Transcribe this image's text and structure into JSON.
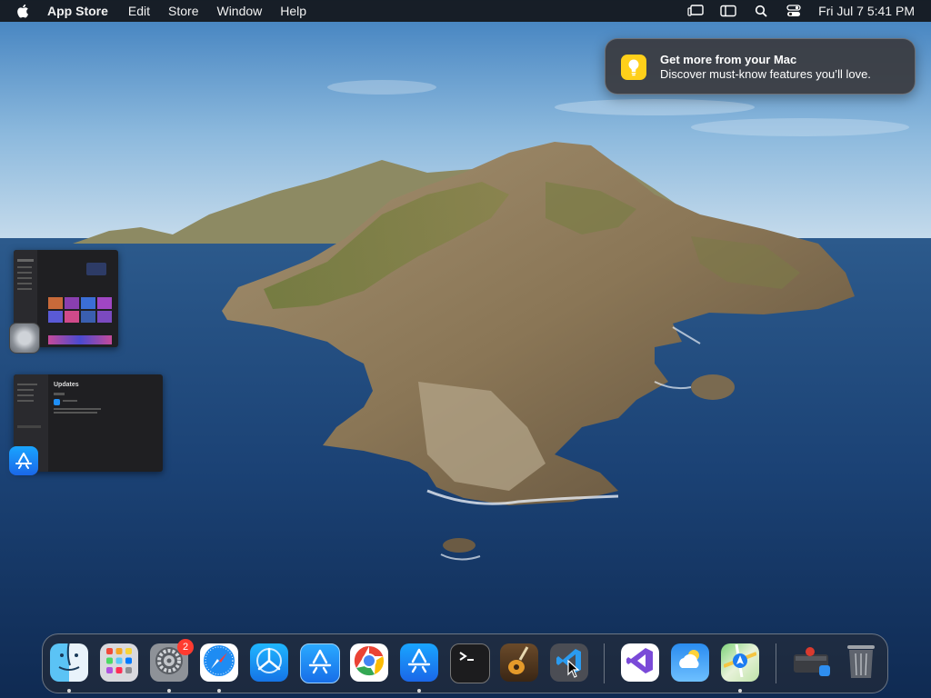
{
  "menubar": {
    "app_name": "App Store",
    "items": [
      "Edit",
      "Store",
      "Window",
      "Help"
    ],
    "status_icons": [
      "stage-manager-icon",
      "sidebar-icon",
      "search-icon",
      "control-center-icon"
    ],
    "clock": "Fri Jul 7  5:41 PM"
  },
  "notification": {
    "title": "Get more from your Mac",
    "body": "Discover must-know features you’ll love.",
    "icon": "lightbulb-icon",
    "accent": "#ffd01a"
  },
  "stage_windows": [
    {
      "app": "System Settings",
      "icon": "system-settings-icon"
    },
    {
      "app": "App Store",
      "icon": "app-store-icon",
      "heading": "Updates"
    }
  ],
  "dock": {
    "apps": [
      {
        "name": "Finder",
        "icon": "finder-icon",
        "running": true
      },
      {
        "name": "Launchpad",
        "icon": "launchpad-icon",
        "running": false
      },
      {
        "name": "System Settings",
        "icon": "system-settings-icon",
        "running": true,
        "badge": "2"
      },
      {
        "name": "Safari",
        "icon": "safari-icon",
        "running": true
      },
      {
        "name": "TestFlight",
        "icon": "testflight-icon",
        "running": false
      },
      {
        "name": "App Store Connect",
        "icon": "app-store-connect-icon",
        "running": false
      },
      {
        "name": "Google Chrome",
        "icon": "chrome-icon",
        "running": false
      },
      {
        "name": "App Store",
        "icon": "app-store-icon",
        "running": true
      },
      {
        "name": "Terminal",
        "icon": "terminal-icon",
        "running": false
      },
      {
        "name": "GarageBand",
        "icon": "garageband-icon",
        "running": false
      },
      {
        "name": "Visual Studio Code",
        "icon": "vscode-icon",
        "running": false
      },
      {
        "name": "Visual Studio",
        "icon": "visual-studio-icon",
        "running": false
      },
      {
        "name": "Weather",
        "icon": "weather-icon",
        "running": false
      },
      {
        "name": "Maps",
        "icon": "maps-icon",
        "running": true
      }
    ],
    "recent": [
      {
        "name": "Downloads",
        "icon": "downloads-stack-icon"
      },
      {
        "name": "Trash",
        "icon": "trash-icon"
      }
    ]
  }
}
